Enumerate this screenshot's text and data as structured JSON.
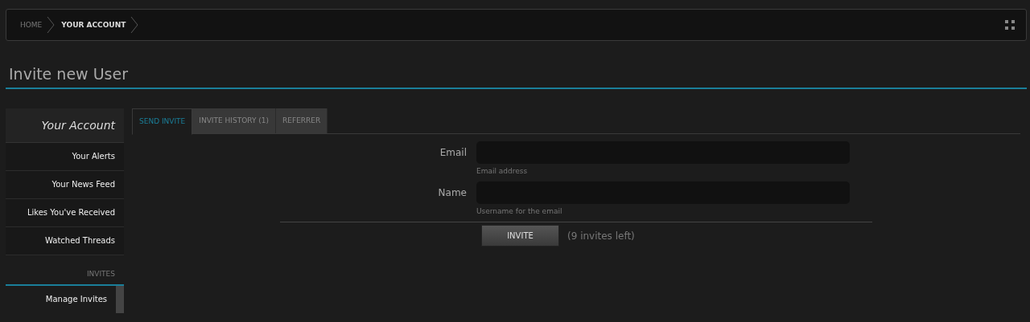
{
  "breadcrumb": [
    {
      "label": "HOME",
      "current": false
    },
    {
      "label": "YOUR ACCOUNT",
      "current": true
    }
  ],
  "page_title": "Invite new User",
  "sidebar": {
    "heading": "Your Account",
    "items": [
      {
        "label": "Your Alerts",
        "selected": false
      },
      {
        "label": "Your News Feed",
        "selected": false
      },
      {
        "label": "Likes You've Received",
        "selected": false
      },
      {
        "label": "Watched Threads",
        "selected": false
      }
    ],
    "section": "INVITES",
    "section_items": [
      {
        "label": "Manage Invites",
        "selected": true
      }
    ]
  },
  "tabs": [
    {
      "label": "SEND INVITE",
      "selected": true
    },
    {
      "label": "INVITE HISTORY (1)",
      "selected": false
    },
    {
      "label": "REFERRER",
      "selected": false
    }
  ],
  "form": {
    "fields": [
      {
        "label": "Email",
        "hint": "Email address"
      },
      {
        "label": "Name",
        "hint": "Username for the email"
      }
    ],
    "button": "INVITE",
    "note": "(9 invites left)"
  }
}
